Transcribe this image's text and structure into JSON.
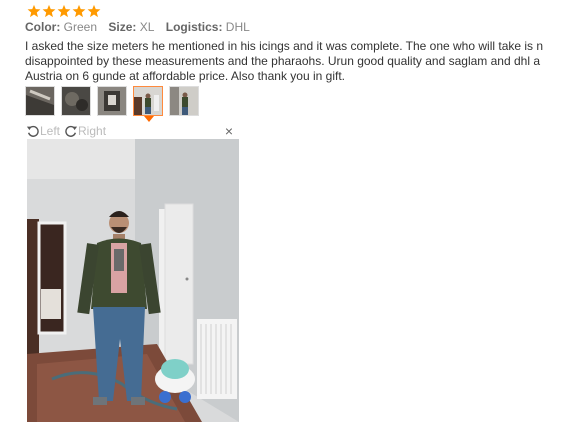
{
  "rating": {
    "stars": 5,
    "max": 5,
    "color": "#ff9a00"
  },
  "attributes": [
    {
      "label": "Color:",
      "value": "Green"
    },
    {
      "label": "Size:",
      "value": "XL"
    },
    {
      "label": "Logistics:",
      "value": "DHL"
    }
  ],
  "review_lines": [
    "I asked the size meters he mentioned in his icings and it was complete. The one who will take is n",
    "disappointed by these measurements and the pharaohs. Urun good quality and saglam and dhl a",
    "Austria on 6 gunde at affordable price. Also thank you in gift."
  ],
  "thumbnails_count": 5,
  "active_thumbnail": 4,
  "viewer": {
    "rotate_left_label": "Left",
    "rotate_right_label": "Right",
    "close_label": "×"
  },
  "colors": {
    "accent": "#ff6a00",
    "text": "#333333",
    "meta": "#888888"
  }
}
